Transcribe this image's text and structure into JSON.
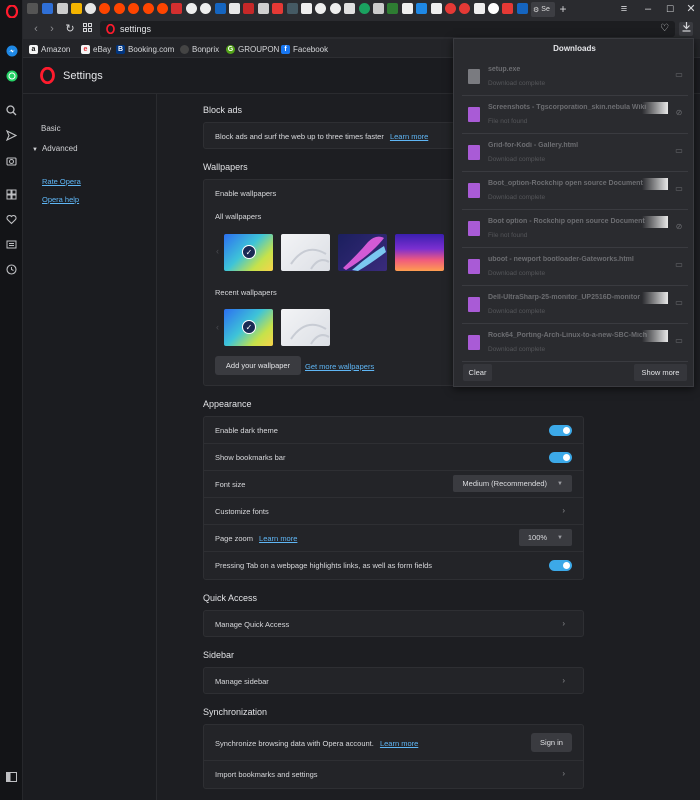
{
  "address": {
    "url": "settings"
  },
  "tabs": {
    "active_label": "Se"
  },
  "bookmarks": [
    {
      "label": "Amazon",
      "icon": "amazon-icon"
    },
    {
      "label": "eBay",
      "icon": "ebay-icon"
    },
    {
      "label": "Booking.com",
      "icon": "booking-icon"
    },
    {
      "label": "Bonprix",
      "icon": "bonprix-icon"
    },
    {
      "label": "GROUPON",
      "icon": "groupon-icon"
    },
    {
      "label": "Facebook",
      "icon": "facebook-icon"
    }
  ],
  "settings": {
    "title": "Settings",
    "nav": {
      "basic": "Basic",
      "advanced": "Advanced",
      "rate": "Rate Opera",
      "help": "Opera help"
    }
  },
  "block_ads": {
    "title": "Block ads",
    "text": "Block ads and surf the web up to three times faster",
    "learn_more": "Learn more"
  },
  "wallpapers": {
    "title": "Wallpapers",
    "enable": "Enable wallpapers",
    "all": "All wallpapers",
    "recent": "Recent wallpapers",
    "add_button": "Add your wallpaper",
    "get_more": "Get more wallpapers"
  },
  "appearance": {
    "title": "Appearance",
    "dark_theme": "Enable dark theme",
    "bookmarks_bar": "Show bookmarks bar",
    "font_size": "Font size",
    "font_size_value": "Medium (Recommended)",
    "customize_fonts": "Customize fonts",
    "page_zoom": "Page zoom",
    "page_zoom_learn": "Learn more",
    "page_zoom_value": "100%",
    "tab_highlight": "Pressing Tab on a webpage highlights links, as well as form fields"
  },
  "quick_access": {
    "title": "Quick Access",
    "manage": "Manage Quick Access"
  },
  "sidebar_section": {
    "title": "Sidebar",
    "manage": "Manage sidebar"
  },
  "sync": {
    "title": "Synchronization",
    "text": "Synchronize browsing data with Opera account.",
    "learn_more": "Learn more",
    "sign_in": "Sign in",
    "import": "Import bookmarks and settings"
  },
  "downloads": {
    "title": "Downloads",
    "items": [
      {
        "name": "setup.exe",
        "status": "Download complete"
      },
      {
        "name": "Screenshots - Tgscorporation_skin.nebula Wiki",
        "status": "File not found"
      },
      {
        "name": "Grid-for-Kodi - Gallery.html",
        "status": "Download complete"
      },
      {
        "name": "Boot_option-Rockchip open source Document",
        "status": "Download complete"
      },
      {
        "name": "Boot option - Rockchip open source Document",
        "status": "File not found"
      },
      {
        "name": "uboot - newport bootloader-Gateworks.html",
        "status": "Download complete"
      },
      {
        "name": "Dell-UltraSharp-25-monitor_UP2516D-monitor",
        "status": "Download complete"
      },
      {
        "name": "Rock64_Porting-Arch-Linux-to-a-new-SBC-Mich",
        "status": "Download complete"
      }
    ],
    "clear": "Clear",
    "show_more": "Show more"
  },
  "colors": {
    "accent": "#3ca9e8",
    "link": "#5fb6f5",
    "opera_red": "#ff1b2d"
  }
}
